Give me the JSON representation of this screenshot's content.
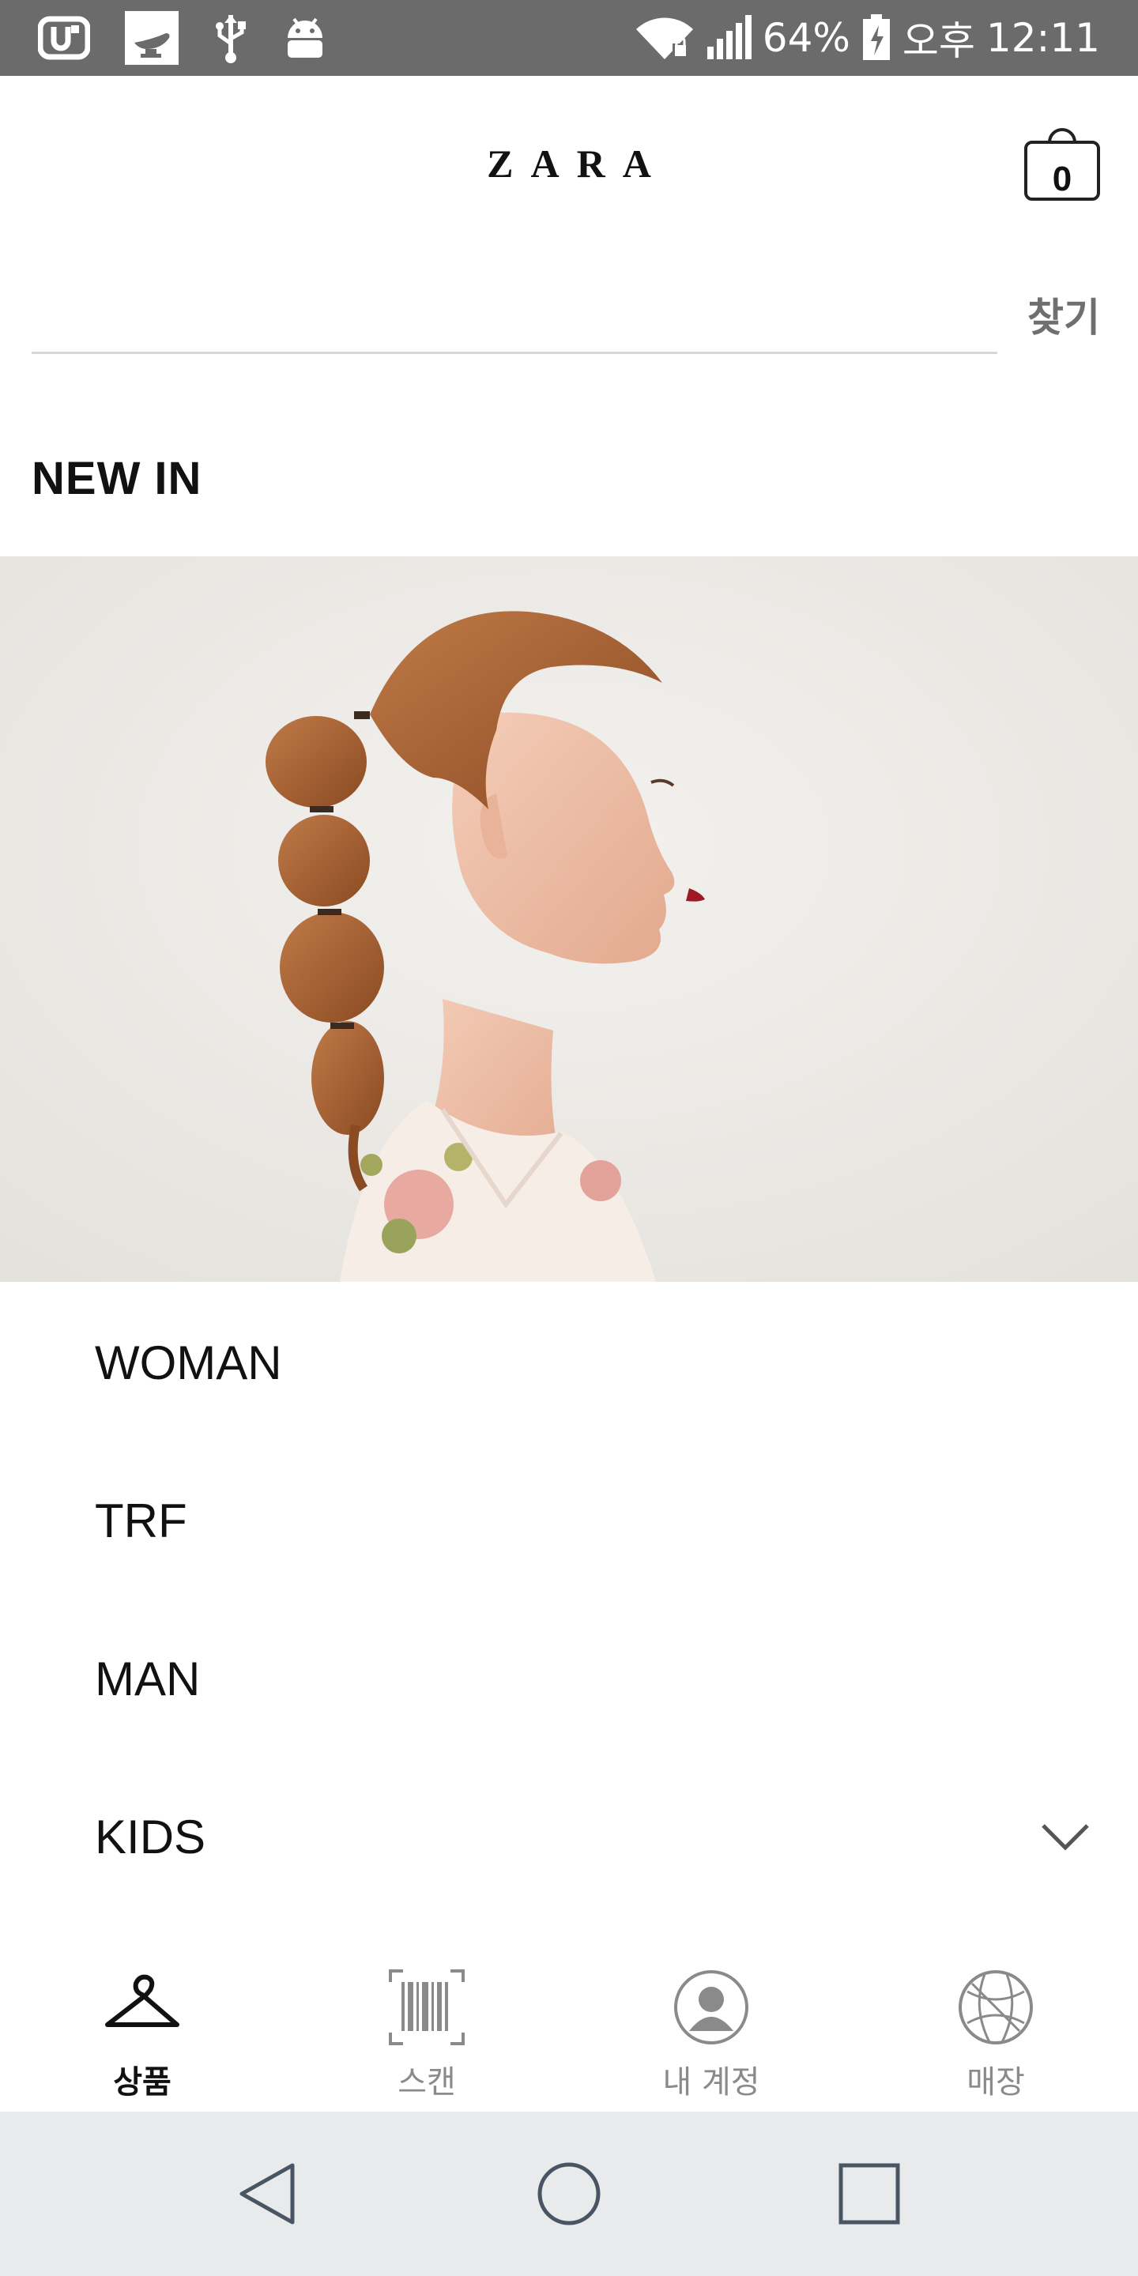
{
  "status_bar": {
    "battery": "64%",
    "ampm": "오후",
    "time": "12:11",
    "left_icons": [
      "u-plus-icon",
      "genie-lamp-icon",
      "usb-icon",
      "android-debug-icon"
    ],
    "right_icons": [
      "wifi-lock-icon",
      "signal-icon",
      "battery-charging-icon"
    ]
  },
  "header": {
    "logo": "ZARA",
    "cart_count": "0"
  },
  "search": {
    "value": "",
    "placeholder": "",
    "button_label": "찾기"
  },
  "section": {
    "title": "NEW IN"
  },
  "categories": [
    {
      "label": "WOMAN"
    },
    {
      "label": "TRF"
    },
    {
      "label": "MAN"
    },
    {
      "label": "KIDS",
      "expandable": true
    }
  ],
  "tabs": [
    {
      "label": "상품",
      "icon": "hanger-icon",
      "active": true
    },
    {
      "label": "스캔",
      "icon": "barcode-scan-icon",
      "active": false
    },
    {
      "label": "내 계정",
      "icon": "account-icon",
      "active": false
    },
    {
      "label": "매장",
      "icon": "globe-icon",
      "active": false
    }
  ],
  "nav": {
    "buttons": [
      "back-icon",
      "home-icon",
      "recents-icon"
    ]
  },
  "colors": {
    "status_bar": "#6b6b6b",
    "nav_bar": "#e9eaec",
    "hero_bg": "#ece9e4",
    "text": "#111111",
    "muted": "#8a8a8a"
  }
}
